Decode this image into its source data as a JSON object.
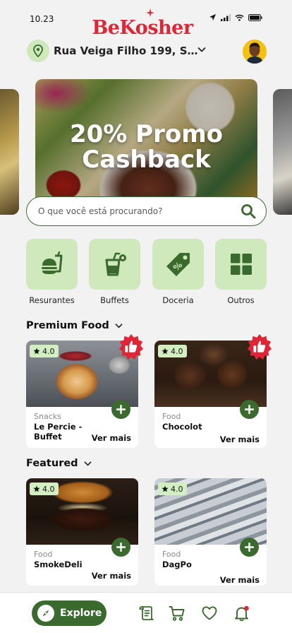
{
  "status": {
    "time": "10.23"
  },
  "brand": {
    "name": "BeKosher",
    "color": "#e02536"
  },
  "location": {
    "address": "Rua Veiga Filho 199, São P..."
  },
  "banner": {
    "line1": "20% Promo",
    "line2": "Cashback"
  },
  "search": {
    "placeholder": "O que você está procurando?"
  },
  "categories": [
    {
      "label": "Resurantes",
      "icon": "burger-drink-icon"
    },
    {
      "label": "Buffets",
      "icon": "drink-icon"
    },
    {
      "label": "Doceria",
      "icon": "tag-icon"
    },
    {
      "label": "Outros",
      "icon": "grid-icon"
    }
  ],
  "premium": {
    "title": "Premium Food",
    "items": [
      {
        "rating": "4.0",
        "category": "Snacks",
        "name": "Le Percie - Buffet",
        "more": "Ver mais",
        "badge": "thumbs-up-icon"
      },
      {
        "rating": "4.0",
        "category": "Food",
        "name": "Chocolot",
        "more": "Ver mais",
        "badge": "thumbs-up-icon"
      }
    ]
  },
  "featured": {
    "title": "Featured",
    "items": [
      {
        "rating": "4.0",
        "category": "Food",
        "name": "SmokeDeli",
        "more": "Ver mais"
      },
      {
        "rating": "4.0",
        "category": "Food",
        "name": "DagPo",
        "more": "Ver mais"
      }
    ]
  },
  "nav": {
    "explore": "Explore"
  },
  "colors": {
    "accent": "#3b6a2f",
    "tile": "#cfe9bd",
    "badge": "#e02536"
  }
}
